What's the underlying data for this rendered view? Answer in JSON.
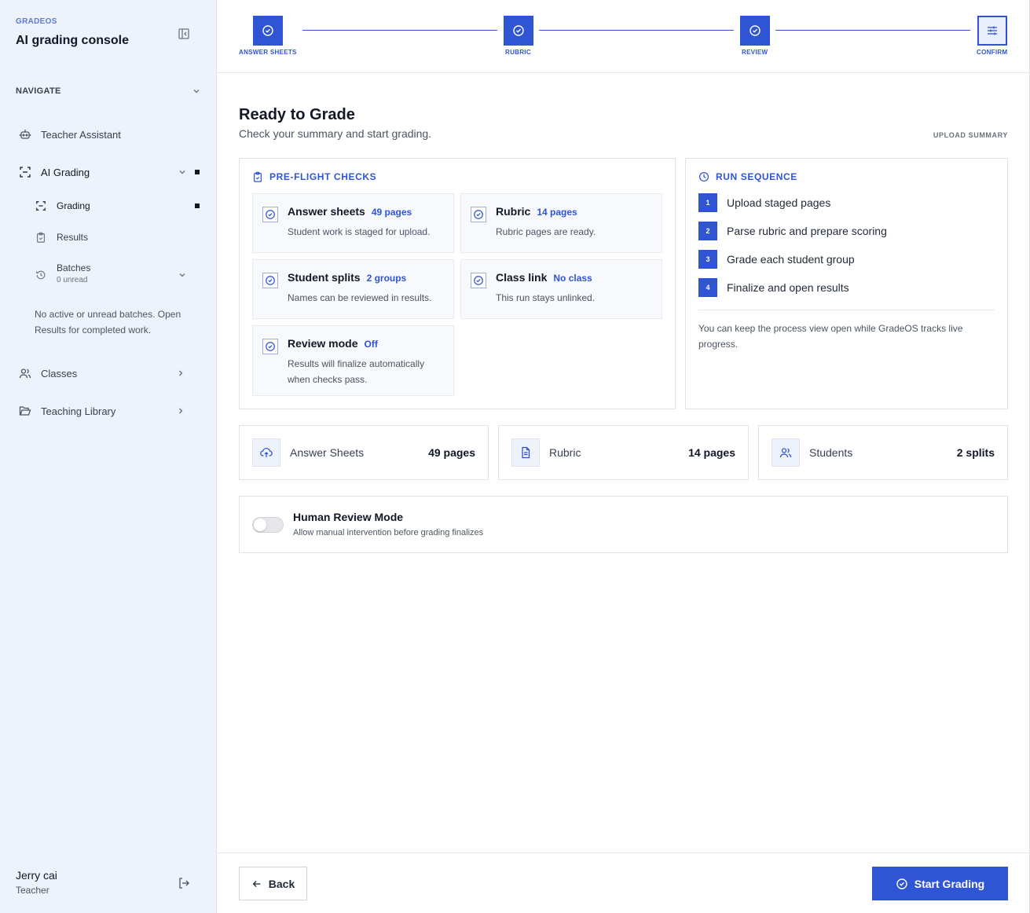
{
  "sidebar": {
    "brand_small": "GRADEOS",
    "brand_title": "AI grading console",
    "nav_header": "NAVIGATE",
    "items": [
      {
        "label": "Teacher Assistant"
      },
      {
        "label": "AI Grading"
      },
      {
        "label": "Classes"
      },
      {
        "label": "Teaching Library"
      }
    ],
    "sub_items": [
      {
        "label": "Grading"
      },
      {
        "label": "Results"
      },
      {
        "label": "Batches",
        "meta": "0 unread"
      }
    ],
    "note": "No active or unread batches. Open Results for completed work.",
    "user_name": "Jerry cai",
    "user_role": "Teacher"
  },
  "stepper": {
    "steps": [
      {
        "label": "ANSWER SHEETS"
      },
      {
        "label": "RUBRIC"
      },
      {
        "label": "REVIEW"
      },
      {
        "label": "CONFIRM"
      }
    ]
  },
  "main": {
    "title": "Ready to Grade",
    "subtitle": "Check your summary and start grading.",
    "upload_summary": "UPLOAD SUMMARY",
    "preflight": {
      "heading": "PRE-FLIGHT CHECKS",
      "checks": [
        {
          "title": "Answer sheets",
          "tag": "49 pages",
          "desc": "Student work is staged for upload."
        },
        {
          "title": "Rubric",
          "tag": "14 pages",
          "desc": "Rubric pages are ready."
        },
        {
          "title": "Student splits",
          "tag": "2 groups",
          "desc": "Names can be reviewed in results."
        },
        {
          "title": "Class link",
          "tag": "No class",
          "desc": "This run stays unlinked."
        },
        {
          "title": "Review mode",
          "tag": "Off",
          "desc": "Results will finalize automatically when checks pass."
        }
      ]
    },
    "run_sequence": {
      "heading": "RUN SEQUENCE",
      "steps": [
        {
          "num": "1",
          "label": "Upload staged pages"
        },
        {
          "num": "2",
          "label": "Parse rubric and prepare scoring"
        },
        {
          "num": "3",
          "label": "Grade each student group"
        },
        {
          "num": "4",
          "label": "Finalize and open results"
        }
      ],
      "note": "You can keep the process view open while GradeOS tracks live progress."
    },
    "stats": [
      {
        "label": "Answer Sheets",
        "value": "49 pages",
        "icon": "upload-cloud-icon"
      },
      {
        "label": "Rubric",
        "value": "14 pages",
        "icon": "document-icon"
      },
      {
        "label": "Students",
        "value": "2 splits",
        "icon": "users-icon"
      }
    ],
    "review_mode": {
      "title": "Human Review Mode",
      "desc": "Allow manual intervention before grading finalizes",
      "enabled": false
    }
  },
  "footer": {
    "back_label": "Back",
    "start_label": "Start Grading"
  },
  "colors": {
    "accent": "#2f55d4",
    "sidebar_bg": "#eef2fb"
  }
}
